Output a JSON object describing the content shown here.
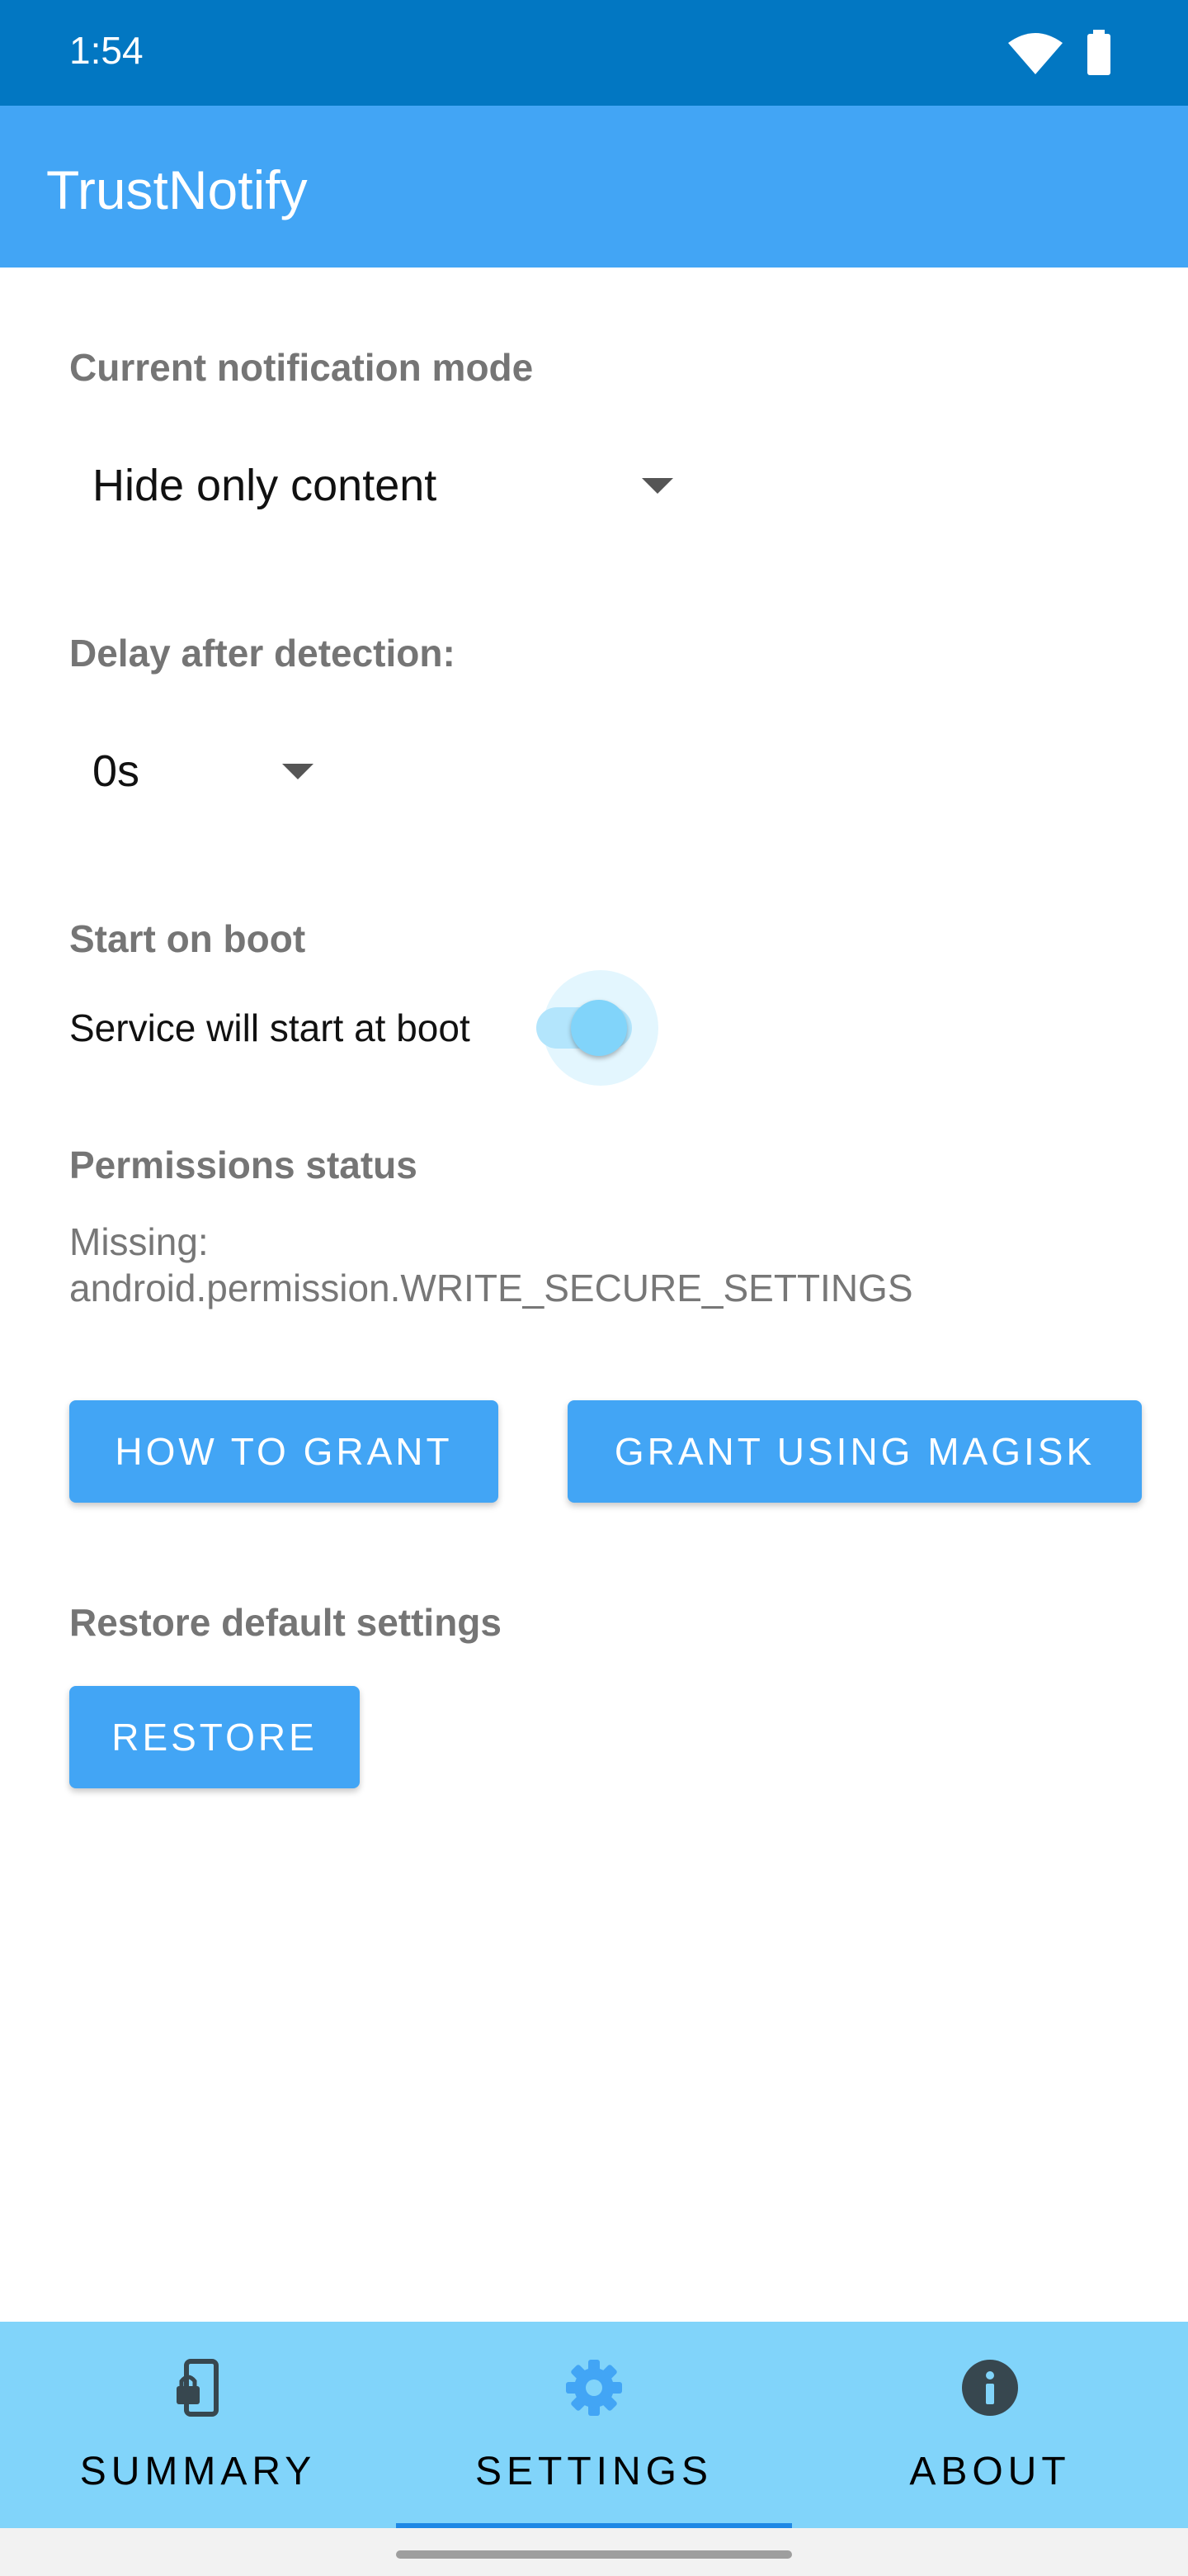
{
  "status_bar": {
    "time": "1:54"
  },
  "app_bar": {
    "title": "TrustNotify"
  },
  "settings": {
    "notification_mode": {
      "label": "Current notification mode",
      "value": "Hide only content"
    },
    "delay": {
      "label": "Delay after detection:",
      "value": "0s"
    },
    "boot": {
      "label": "Start on boot",
      "description": "Service will start at boot",
      "enabled": true
    },
    "permissions": {
      "label": "Permissions status",
      "status_line1": "Missing:",
      "status_line2": "android.permission.WRITE_SECURE_SETTINGS",
      "how_to_grant_label": "HOW TO GRANT",
      "grant_magisk_label": "GRANT USING MAGISK"
    },
    "restore": {
      "label": "Restore default settings",
      "button_label": "RESTORE"
    }
  },
  "bottom_nav": {
    "items": [
      {
        "label": "SUMMARY",
        "icon": "phone-lock-icon"
      },
      {
        "label": "SETTINGS",
        "icon": "gear-icon",
        "selected": true
      },
      {
        "label": "ABOUT",
        "icon": "info-icon"
      }
    ]
  },
  "colors": {
    "status_bar": "#0277C2",
    "app_bar": "#42A5F5",
    "accent": "#42A5F5",
    "bottom_nav": "#81D4FA",
    "selected_icon": "#42A5F5",
    "unselected_icon": "#37474F"
  }
}
